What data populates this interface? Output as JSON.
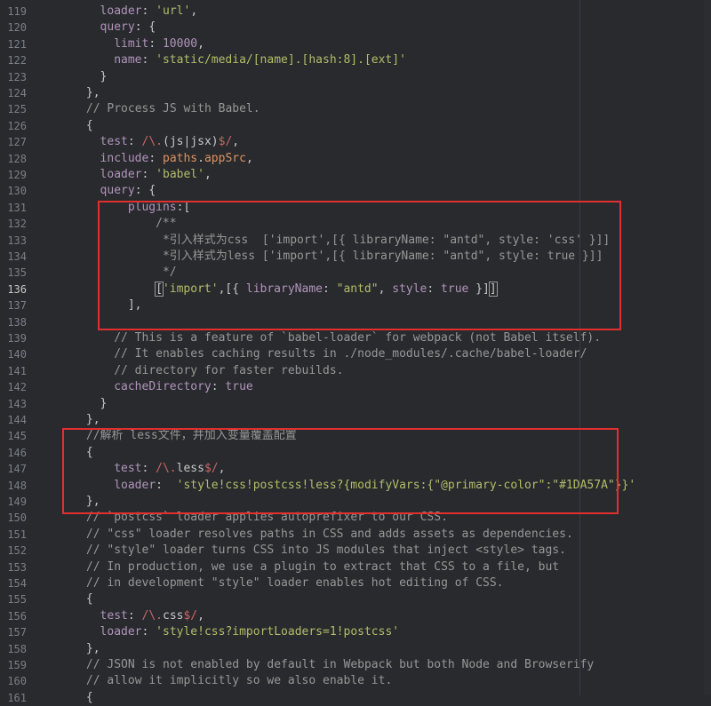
{
  "editor": {
    "current_line": 136,
    "colors": {
      "background": "#282a2e",
      "keyword": "#b294bb",
      "string": "#b5bd68",
      "comment": "#969896",
      "variable": "#de935f",
      "regex": "#cc6666",
      "annotation_box": "#e0302e"
    },
    "lines": [
      {
        "n": 119,
        "indent": 8,
        "tokens": [
          [
            "k",
            "loader"
          ],
          [
            "p",
            ": "
          ],
          [
            "s",
            "'url'"
          ],
          [
            "p",
            ","
          ]
        ]
      },
      {
        "n": 120,
        "indent": 8,
        "tokens": [
          [
            "k",
            "query"
          ],
          [
            "p",
            ": {"
          ]
        ]
      },
      {
        "n": 121,
        "indent": 10,
        "tokens": [
          [
            "k",
            "limit"
          ],
          [
            "p",
            ": "
          ],
          [
            "n",
            "10000"
          ],
          [
            "p",
            ","
          ]
        ]
      },
      {
        "n": 122,
        "indent": 10,
        "tokens": [
          [
            "k",
            "name"
          ],
          [
            "p",
            ": "
          ],
          [
            "s",
            "'static/media/[name].[hash:8].[ext]'"
          ]
        ]
      },
      {
        "n": 123,
        "indent": 8,
        "tokens": [
          [
            "p",
            "}"
          ]
        ]
      },
      {
        "n": 124,
        "indent": 6,
        "tokens": [
          [
            "p",
            "},"
          ]
        ]
      },
      {
        "n": 125,
        "indent": 6,
        "tokens": [
          [
            "c",
            "// Process JS with Babel."
          ]
        ]
      },
      {
        "n": 126,
        "indent": 6,
        "tokens": [
          [
            "p",
            "{"
          ]
        ]
      },
      {
        "n": 127,
        "indent": 8,
        "tokens": [
          [
            "k",
            "test"
          ],
          [
            "p",
            ": "
          ],
          [
            "r",
            "/\\."
          ],
          [
            "p",
            "(js|jsx)"
          ],
          [
            "r",
            "$/"
          ],
          [
            "p",
            ","
          ]
        ]
      },
      {
        "n": 128,
        "indent": 8,
        "tokens": [
          [
            "k",
            "include"
          ],
          [
            "p",
            ": "
          ],
          [
            "v",
            "paths"
          ],
          [
            "p",
            "."
          ],
          [
            "v",
            "appSrc"
          ],
          [
            "p",
            ","
          ]
        ]
      },
      {
        "n": 129,
        "indent": 8,
        "tokens": [
          [
            "k",
            "loader"
          ],
          [
            "p",
            ": "
          ],
          [
            "s",
            "'babel'"
          ],
          [
            "p",
            ","
          ]
        ]
      },
      {
        "n": 130,
        "indent": 8,
        "tokens": [
          [
            "k",
            "query"
          ],
          [
            "p",
            ": {"
          ]
        ]
      },
      {
        "n": 131,
        "indent": 12,
        "tokens": [
          [
            "k",
            "plugins"
          ],
          [
            "p",
            ":["
          ]
        ]
      },
      {
        "n": 132,
        "indent": 16,
        "tokens": [
          [
            "c",
            "/**"
          ]
        ]
      },
      {
        "n": 133,
        "indent": 17,
        "tokens": [
          [
            "c",
            "*引入样式为css  ['import',[{ libraryName: \"antd\", style: 'css' }]]"
          ]
        ]
      },
      {
        "n": 134,
        "indent": 17,
        "tokens": [
          [
            "c",
            "*引入样式为less ['import',[{ libraryName: \"antd\", style: true }]]"
          ]
        ]
      },
      {
        "n": 135,
        "indent": 17,
        "tokens": [
          [
            "c",
            "*/"
          ]
        ]
      },
      {
        "n": 136,
        "indent": 16,
        "tokens": [
          [
            "b",
            "["
          ],
          [
            "s",
            "'import'"
          ],
          [
            "p",
            ",[{ "
          ],
          [
            "k",
            "libraryName"
          ],
          [
            "p",
            ": "
          ],
          [
            "s",
            "\"antd\""
          ],
          [
            "p",
            ", "
          ],
          [
            "k",
            "style"
          ],
          [
            "p",
            ": "
          ],
          [
            "n",
            "true"
          ],
          [
            "p",
            " }]"
          ],
          [
            "b",
            "]"
          ]
        ]
      },
      {
        "n": 137,
        "indent": 12,
        "tokens": [
          [
            "p",
            "],"
          ]
        ]
      },
      {
        "n": 138,
        "indent": 0,
        "tokens": []
      },
      {
        "n": 139,
        "indent": 10,
        "tokens": [
          [
            "c",
            "// This is a feature of `babel-loader` for webpack (not Babel itself)."
          ]
        ]
      },
      {
        "n": 140,
        "indent": 10,
        "tokens": [
          [
            "c",
            "// It enables caching results in ./node_modules/.cache/babel-loader/"
          ]
        ]
      },
      {
        "n": 141,
        "indent": 10,
        "tokens": [
          [
            "c",
            "// directory for faster rebuilds."
          ]
        ]
      },
      {
        "n": 142,
        "indent": 10,
        "tokens": [
          [
            "k",
            "cacheDirectory"
          ],
          [
            "p",
            ": "
          ],
          [
            "n",
            "true"
          ]
        ]
      },
      {
        "n": 143,
        "indent": 8,
        "tokens": [
          [
            "p",
            "}"
          ]
        ]
      },
      {
        "n": 144,
        "indent": 6,
        "tokens": [
          [
            "p",
            "},"
          ]
        ]
      },
      {
        "n": 145,
        "indent": 6,
        "tokens": [
          [
            "c",
            "//解析 less文件，并加入变量覆盖配置"
          ]
        ]
      },
      {
        "n": 146,
        "indent": 6,
        "tokens": [
          [
            "p",
            "{"
          ]
        ]
      },
      {
        "n": 147,
        "indent": 10,
        "tokens": [
          [
            "k",
            "test"
          ],
          [
            "p",
            ": "
          ],
          [
            "r",
            "/\\."
          ],
          [
            "p",
            "less"
          ],
          [
            "r",
            "$/"
          ],
          [
            "p",
            ","
          ]
        ]
      },
      {
        "n": 148,
        "indent": 10,
        "tokens": [
          [
            "k",
            "loader"
          ],
          [
            "p",
            ":  "
          ],
          [
            "s",
            "'style!css!postcss!less?{modifyVars:{\"@primary-color\":\"#1DA57A\"}}'"
          ]
        ]
      },
      {
        "n": 149,
        "indent": 6,
        "tokens": [
          [
            "p",
            "},"
          ]
        ]
      },
      {
        "n": 150,
        "indent": 6,
        "tokens": [
          [
            "c",
            "// `postcss` loader applies autoprefixer to our CSS."
          ]
        ]
      },
      {
        "n": 151,
        "indent": 6,
        "tokens": [
          [
            "c",
            "// \"css\" loader resolves paths in CSS and adds assets as dependencies."
          ]
        ]
      },
      {
        "n": 152,
        "indent": 6,
        "tokens": [
          [
            "c",
            "// \"style\" loader turns CSS into JS modules that inject <style> tags."
          ]
        ]
      },
      {
        "n": 153,
        "indent": 6,
        "tokens": [
          [
            "c",
            "// In production, we use a plugin to extract that CSS to a file, but"
          ]
        ]
      },
      {
        "n": 154,
        "indent": 6,
        "tokens": [
          [
            "c",
            "// in development \"style\" loader enables hot editing of CSS."
          ]
        ]
      },
      {
        "n": 155,
        "indent": 6,
        "tokens": [
          [
            "p",
            "{"
          ]
        ]
      },
      {
        "n": 156,
        "indent": 8,
        "tokens": [
          [
            "k",
            "test"
          ],
          [
            "p",
            ": "
          ],
          [
            "r",
            "/\\."
          ],
          [
            "p",
            "css"
          ],
          [
            "r",
            "$/"
          ],
          [
            "p",
            ","
          ]
        ]
      },
      {
        "n": 157,
        "indent": 8,
        "tokens": [
          [
            "k",
            "loader"
          ],
          [
            "p",
            ": "
          ],
          [
            "s",
            "'style!css?importLoaders=1!postcss'"
          ]
        ]
      },
      {
        "n": 158,
        "indent": 6,
        "tokens": [
          [
            "p",
            "},"
          ]
        ]
      },
      {
        "n": 159,
        "indent": 6,
        "tokens": [
          [
            "c",
            "// JSON is not enabled by default in Webpack but both Node and Browserify"
          ]
        ]
      },
      {
        "n": 160,
        "indent": 6,
        "tokens": [
          [
            "c",
            "// allow it implicitly so we also enable it."
          ]
        ]
      },
      {
        "n": 161,
        "indent": 6,
        "tokens": [
          [
            "p",
            "{"
          ]
        ]
      }
    ]
  }
}
